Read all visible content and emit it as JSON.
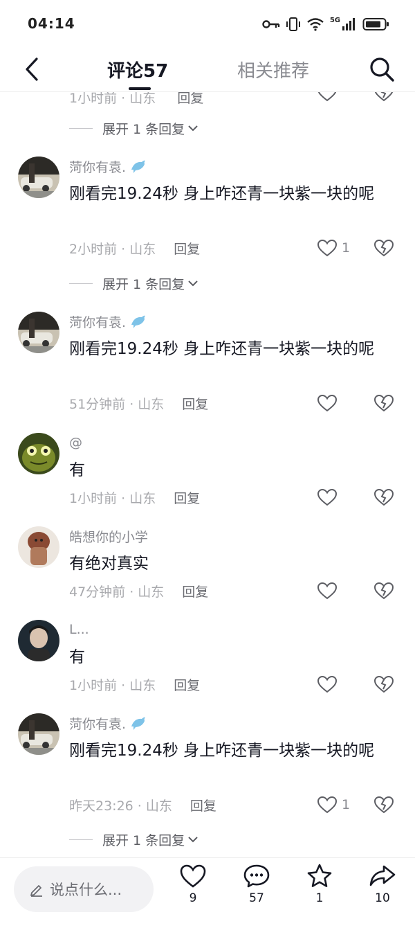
{
  "status_bar": {
    "time": "04:14",
    "network": "5G"
  },
  "header": {
    "back_icon": "chevron-left-icon",
    "tabs": [
      {
        "label": "评论57",
        "active": true
      },
      {
        "label": "相关推荐",
        "active": false
      }
    ],
    "search_icon": "search-icon"
  },
  "partial_row": {
    "time": "1小时前 · 山东",
    "reply": "回复"
  },
  "expand_label": "展开 1 条回复",
  "comments": [
    {
      "username": "菏你有袁.",
      "badge": "dolphin-icon",
      "text": "刚看完19.24秒  身上咋还青一块紫一块的呢",
      "meta": "2小时前 · 山东",
      "reply": "回复",
      "likes": "1"
    },
    {
      "username": "菏你有袁.",
      "badge": "dolphin-icon",
      "text": "刚看完19.24秒  身上咋还青一块紫一块的呢",
      "meta": "51分钟前 · 山东",
      "reply": "回复",
      "likes": ""
    },
    {
      "username": "@",
      "text": "有",
      "meta": "1小时前 · 山东",
      "reply": "回复",
      "likes": ""
    },
    {
      "username": "皓想你的小学",
      "text": "有绝对真实",
      "meta": "47分钟前 · 山东",
      "reply": "回复",
      "likes": ""
    },
    {
      "username": "L...",
      "text": "有",
      "meta": "1小时前 · 山东",
      "reply": "回复",
      "likes": ""
    },
    {
      "username": "菏你有袁.",
      "badge": "dolphin-icon",
      "text": "刚看完19.24秒  身上咋还青一块紫一块的呢",
      "meta": "昨天23:26 · 山东",
      "reply": "回复",
      "likes": "1"
    }
  ],
  "bottom_bar": {
    "input_placeholder": "说点什么...",
    "like_count": "9",
    "comment_count": "57",
    "favorite_count": "1",
    "share_count": "10"
  },
  "colors": {
    "text": "#161823",
    "secondary": "#8a8b91",
    "dolphin": "#7ec3e8"
  }
}
